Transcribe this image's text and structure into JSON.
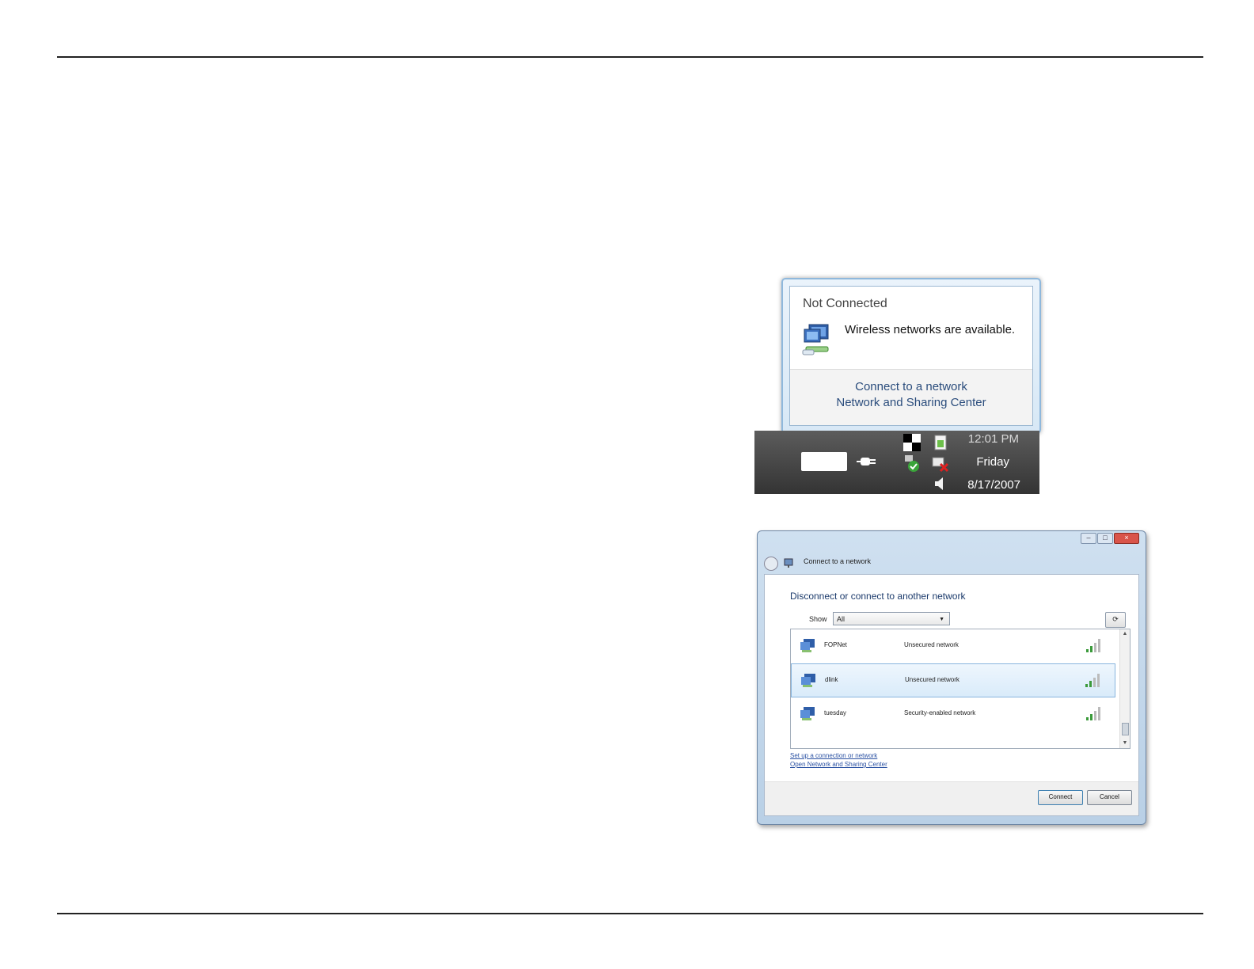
{
  "balloon": {
    "title": "Not Connected",
    "message": "Wireless networks are available.",
    "links": [
      "Connect to a network",
      "Network and Sharing Center"
    ]
  },
  "taskbar": {
    "time": "12:01 PM",
    "day": "Friday",
    "date": "8/17/2007"
  },
  "dialog": {
    "title": "Connect to a network",
    "heading": "Disconnect or connect to another network",
    "show_label": "Show",
    "show_value": "All",
    "networks": [
      {
        "name": "FOPNet",
        "status": "Unsecured network",
        "selected": false
      },
      {
        "name": "dlink",
        "status": "Unsecured network",
        "selected": true
      },
      {
        "name": "tuesday",
        "status": "Security-enabled network",
        "selected": false
      }
    ],
    "links": [
      "Set up a connection or network",
      "Open Network and Sharing Center"
    ],
    "connect_label": "Connect",
    "cancel_label": "Cancel"
  },
  "colors": {
    "link_blue": "#2a4c7c",
    "selected_row": "#d9ebfa",
    "taskbar": "#3f3f3f"
  }
}
